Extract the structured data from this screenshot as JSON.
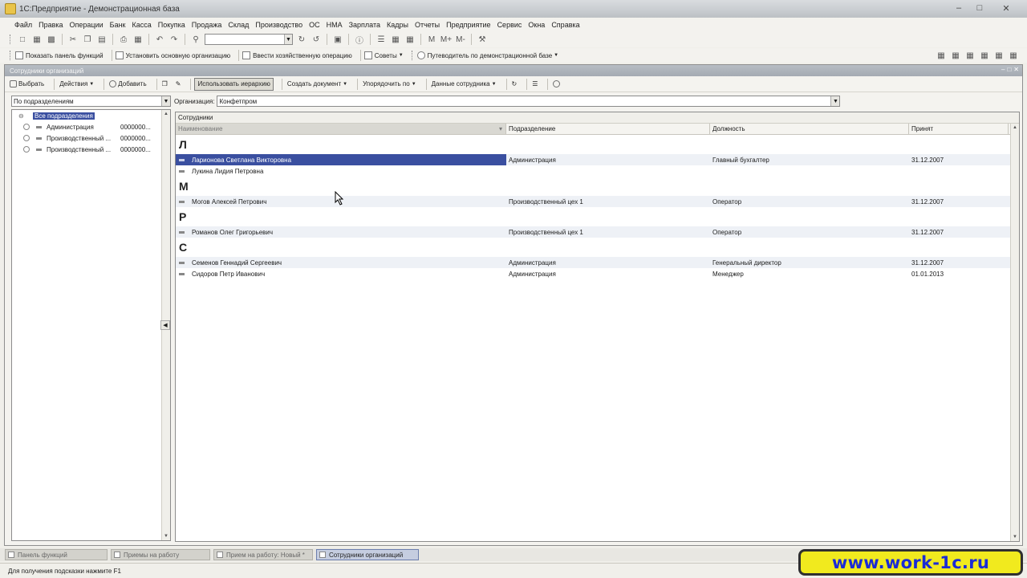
{
  "window": {
    "title": "1С:Предприятие - Демонстрационная база"
  },
  "menu": [
    "Файл",
    "Правка",
    "Операции",
    "Банк",
    "Касса",
    "Покупка",
    "Продажа",
    "Склад",
    "Производство",
    "ОС",
    "НМА",
    "Зарплата",
    "Кадры",
    "Отчеты",
    "Предприятие",
    "Сервис",
    "Окна",
    "Справка"
  ],
  "toolbar2": {
    "show_panel": "Показать панель функций",
    "set_org": "Установить основную организацию",
    "enter_op": "Ввести хозяйственную операцию",
    "tips": "Советы",
    "guide": "Путеводитель по демонстрационной базе"
  },
  "form": {
    "title": "Сотрудники организаций",
    "buttons": {
      "select": "Выбрать",
      "actions": "Действия",
      "add": "Добавить",
      "hierarchy": "Использовать иерархию",
      "create_doc": "Создать документ",
      "order_by": "Упорядочить по",
      "employee_data": "Данные сотрудника"
    },
    "grouping": "По подразделениям",
    "org_label": "Организация:",
    "org_value": "Конфетпром"
  },
  "tree": {
    "root": "Все подразделения",
    "items": [
      {
        "name": "Администрация",
        "code": "0000000..."
      },
      {
        "name": "Производственный ...",
        "code": "0000000..."
      },
      {
        "name": "Производственный ...",
        "code": "0000000..."
      }
    ]
  },
  "list": {
    "title": "Сотрудники",
    "columns": [
      "Наименование",
      "Подразделение",
      "Должность",
      "Принят"
    ],
    "groups": [
      {
        "letter": "Л",
        "rows": [
          {
            "name": "Ларионова Светлана Викторовна",
            "dept": "Администрация",
            "pos": "Главный бухгалтер",
            "date": "31.12.2007",
            "selected": true
          },
          {
            "name": "Лукина  Лидия Петровна",
            "dept": "",
            "pos": "",
            "date": ""
          }
        ]
      },
      {
        "letter": "М",
        "rows": [
          {
            "name": "Могов Алексей Петрович",
            "dept": "Производственный цех 1",
            "pos": "Оператор",
            "date": "31.12.2007"
          }
        ]
      },
      {
        "letter": "Р",
        "rows": [
          {
            "name": "Романов Олег Григорьевич",
            "dept": "Производственный цех 1",
            "pos": "Оператор",
            "date": "31.12.2007"
          }
        ]
      },
      {
        "letter": "С",
        "rows": [
          {
            "name": "Семенов Геннадий Сергеевич",
            "dept": "Администрация",
            "pos": "Генеральный директор",
            "date": "31.12.2007"
          },
          {
            "name": "Сидоров Петр Иванович",
            "dept": "Администрация",
            "pos": "Менеджер",
            "date": "01.01.2013"
          }
        ]
      }
    ]
  },
  "taskbar": [
    "Панель функций",
    "Приемы на работу",
    "Прием на работу: Новый *",
    "Сотрудники организаций"
  ],
  "status": "Для получения подсказки нажмите F1",
  "watermark": "www.work-1c.ru"
}
